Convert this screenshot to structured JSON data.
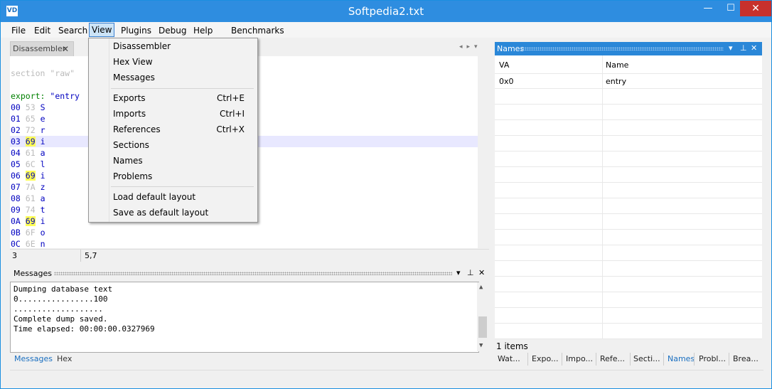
{
  "window": {
    "title": "Softpedia2.txt",
    "icon_label": "VD",
    "min": "—",
    "max": "☐",
    "close": "✕"
  },
  "menubar": {
    "items": [
      "File",
      "Edit",
      "Search",
      "View",
      "Plugins",
      "Debug",
      "Help",
      "Benchmarks"
    ]
  },
  "view_menu": {
    "items": [
      {
        "label": "Disassembler",
        "shortcut": ""
      },
      {
        "label": "Hex View",
        "shortcut": ""
      },
      {
        "label": "Messages",
        "shortcut": ""
      },
      {
        "label": "Exports",
        "shortcut": "Ctrl+E"
      },
      {
        "label": "Imports",
        "shortcut": "Ctrl+I"
      },
      {
        "label": "References",
        "shortcut": "Ctrl+X"
      },
      {
        "label": "Sections",
        "shortcut": ""
      },
      {
        "label": "Names",
        "shortcut": ""
      },
      {
        "label": "Problems",
        "shortcut": ""
      },
      {
        "label": "Load default layout",
        "shortcut": ""
      },
      {
        "label": "Save as default layout",
        "shortcut": ""
      }
    ]
  },
  "disassembler": {
    "tab_label": "Disassembler",
    "tab_close": "✕",
    "section_line": "section \"raw\"",
    "export_keyword": "export:",
    "export_value": "\"entry",
    "rows": [
      {
        "addr": "00",
        "hex": "53",
        "ch": "S",
        "hl": false
      },
      {
        "addr": "01",
        "hex": "65",
        "ch": "e",
        "hl": false
      },
      {
        "addr": "02",
        "hex": "72",
        "ch": "r",
        "hl": false
      },
      {
        "addr": "03",
        "hex": "69",
        "ch": "i",
        "hl": true
      },
      {
        "addr": "04",
        "hex": "61",
        "ch": "a",
        "hl": false
      },
      {
        "addr": "05",
        "hex": "6C",
        "ch": "l",
        "hl": false
      },
      {
        "addr": "06",
        "hex": "69",
        "ch": "i",
        "hl": true
      },
      {
        "addr": "07",
        "hex": "7A",
        "ch": "z",
        "hl": false
      },
      {
        "addr": "08",
        "hex": "61",
        "ch": "a",
        "hl": false
      },
      {
        "addr": "09",
        "hex": "74",
        "ch": "t",
        "hl": false
      },
      {
        "addr": "0A",
        "hex": "69",
        "ch": "i",
        "hl": true
      },
      {
        "addr": "0B",
        "hex": "6F",
        "ch": "o",
        "hl": false
      },
      {
        "addr": "0C",
        "hex": "6E",
        "ch": "n",
        "hl": false
      }
    ],
    "status_line": "3",
    "status_pos": "5,7"
  },
  "messages": {
    "title": "Messages",
    "lines": [
      "Dumping database text",
      "0................100",
      "...................",
      "Complete dump saved.",
      "Time elapsed: 00:00:00.0327969"
    ]
  },
  "bottom_left_tabs": [
    "Messages",
    "Hex"
  ],
  "names_panel": {
    "title": "Names",
    "columns": [
      "VA",
      "Name"
    ],
    "rows": [
      {
        "va": "0x0",
        "name": "entry"
      }
    ],
    "item_count": "1 items"
  },
  "bottom_right_tabs": [
    "Wat...",
    "Expo...",
    "Impo...",
    "Refe...",
    "Secti...",
    "Names",
    "Probl...",
    "Brea..."
  ],
  "pane_controls": {
    "dropdown": "▾",
    "pin": "⊥",
    "close": "✕"
  }
}
